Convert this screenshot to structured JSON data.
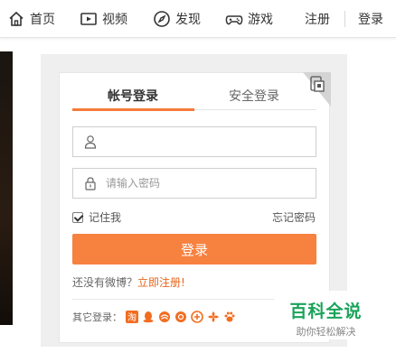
{
  "nav": {
    "home": "首页",
    "video": "视频",
    "discover": "发现",
    "game": "游戏",
    "register": "注册",
    "login": "登录"
  },
  "login_card": {
    "tab_account": "帐号登录",
    "tab_secure": "安全登录",
    "username_placeholder": "",
    "password_placeholder": "请输入密码",
    "remember_label": "记住我",
    "remember_checked": true,
    "forgot_label": "忘记密码",
    "login_button": "登录",
    "no_account_text": "还没有微博？",
    "register_link": "立即注册!",
    "other_login_label": "其它登录：",
    "social_icons": [
      "taobao-icon",
      "qq-icon",
      "sina-icon",
      "email-icon",
      "qq-browser-icon",
      "unicom-icon",
      "baidu-icon"
    ]
  },
  "watermark": {
    "title": "百科全说",
    "subtitle": "助你轻松解决"
  },
  "colors": {
    "accent": "#f7813f",
    "link": "#e8661e",
    "watermark_green": "#1aa35a"
  }
}
